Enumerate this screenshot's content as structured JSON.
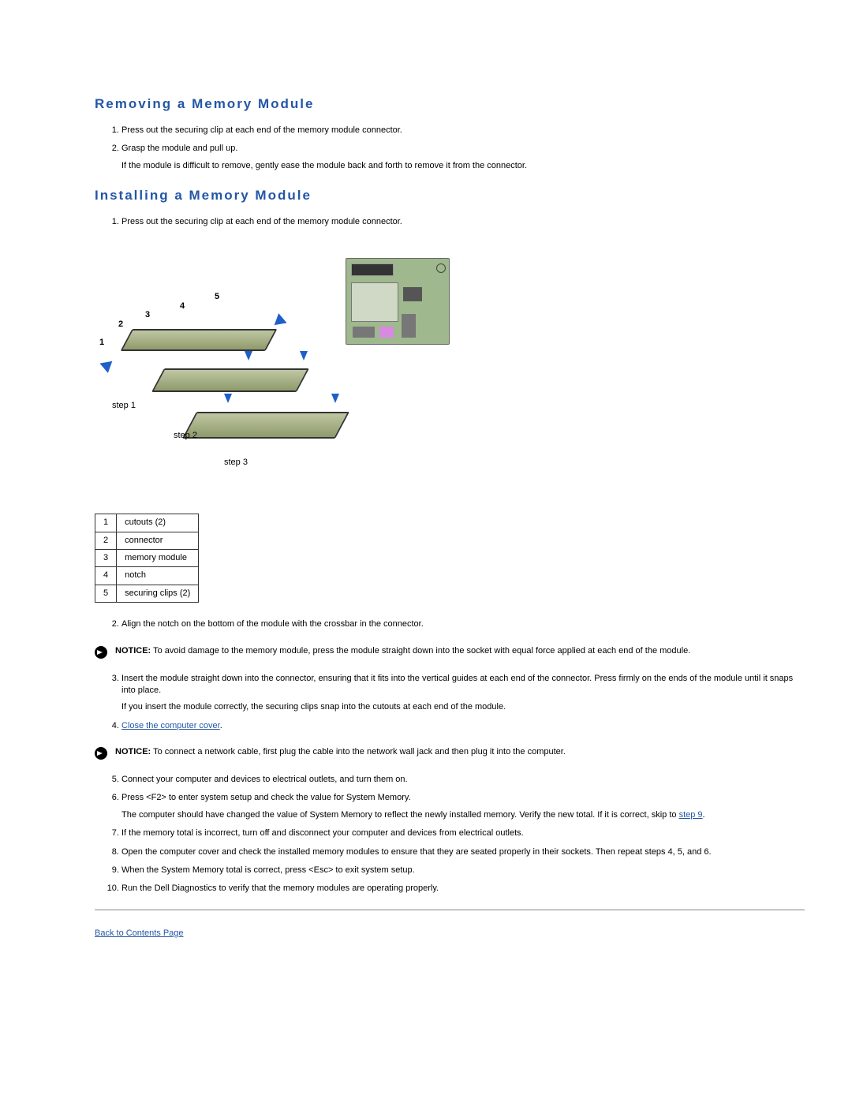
{
  "sections": {
    "removing_title": "Removing a Memory Module",
    "installing_title": "Installing a Memory Module"
  },
  "removing_steps": {
    "s1": "Press out the securing clip at each end of the memory module connector.",
    "s2": "Grasp the module and pull up.",
    "s2_sub": "If the module is difficult to remove, gently ease the module back and forth to remove it from the connector."
  },
  "installing_step1": "Press out the securing clip at each end of the memory module connector.",
  "figure_labels": {
    "n1": "1",
    "n2": "2",
    "n3": "3",
    "n4": "4",
    "n5": "5",
    "step1": "step 1",
    "step2": "step 2",
    "step3": "step 3"
  },
  "callouts": [
    {
      "num": "1",
      "label": "cutouts (2)"
    },
    {
      "num": "2",
      "label": "connector"
    },
    {
      "num": "3",
      "label": "memory module"
    },
    {
      "num": "4",
      "label": "notch"
    },
    {
      "num": "5",
      "label": "securing clips (2)"
    }
  ],
  "installing_after_fig": {
    "s2": "Align the notch on the bottom of the module with the crossbar in the connector."
  },
  "notice1": {
    "label": "NOTICE:",
    "text": "To avoid damage to the memory module, press the module straight down into the socket with equal force applied at each end of the module."
  },
  "installing_after_notice1": {
    "s3": "Insert the module straight down into the connector, ensuring that it fits into the vertical guides at each end of the connector. Press firmly on the ends of the module until it snaps into place.",
    "s3_sub": "If you insert the module correctly, the securing clips snap into the cutouts at each end of the module.",
    "s4_link": "Close the computer cover",
    "s4_suffix": "."
  },
  "notice2": {
    "label": "NOTICE:",
    "text": "To connect a network cable, first plug the cable into the network wall jack and then plug it into the computer."
  },
  "installing_after_notice2": {
    "s5": "Connect your computer and devices to electrical outlets, and turn them on.",
    "s6": "Press <F2> to enter system setup and check the value for System Memory.",
    "s6_sub_pre": "The computer should have changed the value of System Memory to reflect the newly installed memory. Verify the new total. If it is correct, skip to ",
    "s6_sub_link": "step 9",
    "s6_sub_post": ".",
    "s7": "If the memory total is incorrect, turn off and disconnect your computer and devices from electrical outlets.",
    "s8": "Open the computer cover and check the installed memory modules to ensure that they are seated properly in their sockets. Then repeat steps 4, 5, and 6.",
    "s9": "When the System Memory total is correct, press <Esc> to exit system setup.",
    "s10": "Run the Dell Diagnostics to verify that the memory modules are operating properly."
  },
  "back_link": "Back to Contents Page"
}
